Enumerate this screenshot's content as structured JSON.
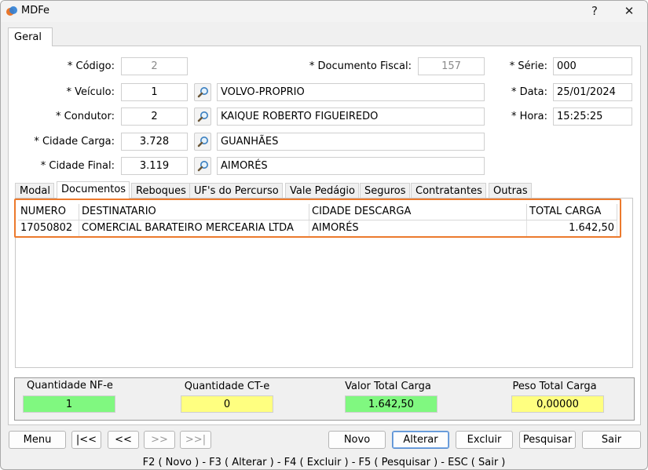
{
  "window": {
    "title": "MDFe",
    "help_label": "?",
    "close_label": "✕",
    "icon": "mdfe-app-icon"
  },
  "tabs": {
    "main": "Geral"
  },
  "form": {
    "codigo": {
      "label": "* Código:",
      "value": "2"
    },
    "documento_fiscal": {
      "label": "* Documento Fiscal:",
      "value": "157"
    },
    "serie": {
      "label": "* Série:",
      "value": "000"
    },
    "veiculo": {
      "label": "* Veículo:",
      "code": "1",
      "name": "VOLVO-PROPRIO"
    },
    "data": {
      "label": "* Data:",
      "value": "25/01/2024"
    },
    "condutor": {
      "label": "* Condutor:",
      "code": "2",
      "name": "KAIQUE ROBERTO FIGUEIREDO"
    },
    "hora": {
      "label": "* Hora:",
      "value": "15:25:25"
    },
    "cidade_carga": {
      "label": "* Cidade Carga:",
      "code": "3.728",
      "name": "GUANHÃES"
    },
    "cidade_final": {
      "label": "* Cidade Final:",
      "code": "3.119",
      "name": "AIMORÉS"
    }
  },
  "subtabs": [
    "Modal",
    "Documentos",
    "Reboques",
    "UF's do Percurso",
    "Vale Pedágio",
    "Seguros",
    "Contratantes",
    "Outras"
  ],
  "grid": {
    "headers": [
      "NUMERO",
      "DESTINATARIO",
      "CIDADE DESCARGA",
      "TOTAL CARGA"
    ],
    "rows": [
      [
        "17050802",
        "COMERCIAL BARATEIRO MERCEARIA LTDA",
        "AIMORÉS",
        "1.642,50"
      ]
    ]
  },
  "summary": {
    "qtd_nfe": {
      "label": "Quantidade NF-e",
      "value": "1",
      "color": "#80f880"
    },
    "qtd_cte": {
      "label": "Quantidade CT-e",
      "value": "0",
      "color": "#ffff80"
    },
    "valor_total": {
      "label": "Valor Total Carga",
      "value": "1.642,50",
      "color": "#80f880"
    },
    "peso_total": {
      "label": "Peso Total Carga",
      "value": "0,00000",
      "color": "#ffff80"
    }
  },
  "buttons": {
    "menu": "Menu",
    "first": "|<<",
    "prev": "<<",
    "next": ">>",
    "last": ">>|",
    "novo": "Novo",
    "alterar": "Alterar",
    "excluir": "Excluir",
    "pesquisar": "Pesquisar",
    "sair": "Sair"
  },
  "status": "F2 ( Novo )  -  F3 ( Alterar )  -  F4 ( Excluir )  -  F5 ( Pesquisar )  -  ESC ( Sair )",
  "colors": {
    "highlight": "#ec7a2d",
    "focus": "#5a8fd0"
  }
}
